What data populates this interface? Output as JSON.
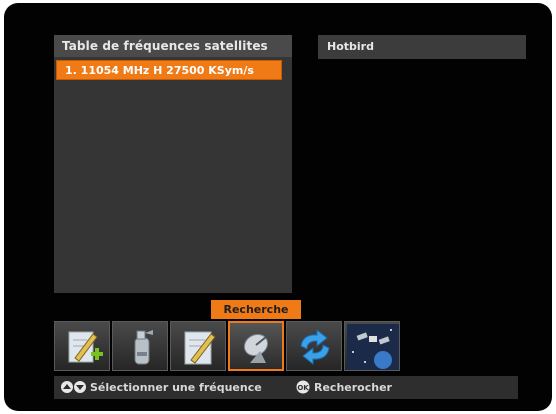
{
  "frequency_panel": {
    "title": "Table de fréquences satellites",
    "items": [
      {
        "label": "1. 11054 MHz H 27500 KSym/s",
        "selected": true
      }
    ]
  },
  "satellite_panel": {
    "title": "Hotbird"
  },
  "tooltip": {
    "label": "Recherche"
  },
  "toolbar": {
    "buttons": [
      {
        "icon": "edit-add-icon",
        "selected": false
      },
      {
        "icon": "fire-extinguisher-icon",
        "selected": false
      },
      {
        "icon": "edit-pencil-icon",
        "selected": false
      },
      {
        "icon": "satellite-dish-icon",
        "selected": true
      },
      {
        "icon": "swap-arrows-icon",
        "selected": false
      },
      {
        "icon": "satellite-space-icon",
        "selected": false
      }
    ]
  },
  "statusbar": {
    "select_hint": "Sélectionner une fréquence",
    "ok_hint": "Recherocher"
  },
  "colors": {
    "accent": "#f07a16",
    "panel": "#353535",
    "background": "#020202"
  }
}
